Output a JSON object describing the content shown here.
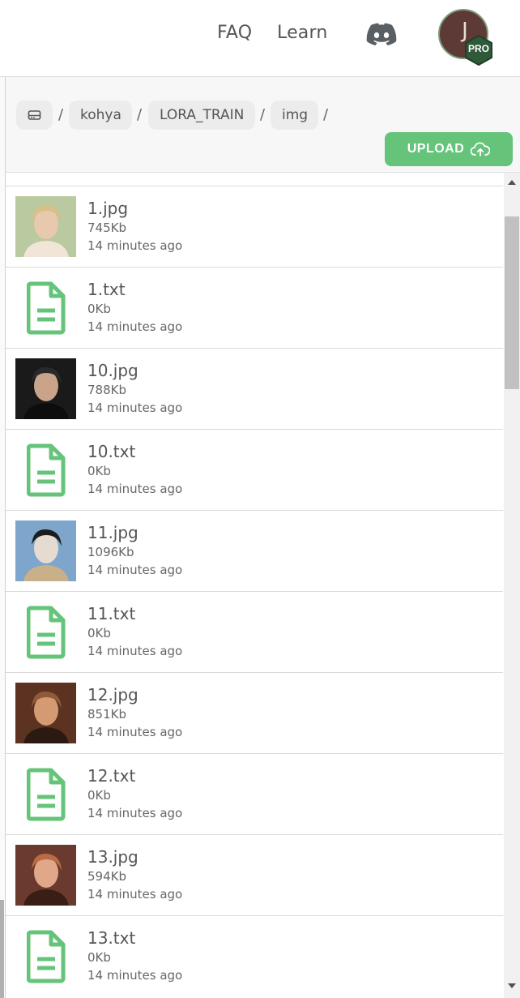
{
  "header": {
    "nav": [
      "FAQ",
      "Learn"
    ],
    "discord_icon": "discord-icon",
    "avatar_letter": "J",
    "badge": "PRO"
  },
  "breadcrumb": {
    "root_icon": "drive-icon",
    "items": [
      "kohya",
      "LORA_TRAIN",
      "img"
    ],
    "separator": "/"
  },
  "upload": {
    "label": "UPLOAD",
    "icon": "cloud-upload-icon"
  },
  "colors": {
    "accent": "#65c37a",
    "text": "#555555",
    "avatar_bg": "#5e3a36"
  },
  "files": [
    {
      "name": "1.jpg",
      "size": "745Kb",
      "time": "14 minutes ago",
      "kind": "image"
    },
    {
      "name": "1.txt",
      "size": "0Kb",
      "time": "14 minutes ago",
      "kind": "text"
    },
    {
      "name": "10.jpg",
      "size": "788Kb",
      "time": "14 minutes ago",
      "kind": "image"
    },
    {
      "name": "10.txt",
      "size": "0Kb",
      "time": "14 minutes ago",
      "kind": "text"
    },
    {
      "name": "11.jpg",
      "size": "1096Kb",
      "time": "14 minutes ago",
      "kind": "image"
    },
    {
      "name": "11.txt",
      "size": "0Kb",
      "time": "14 minutes ago",
      "kind": "text"
    },
    {
      "name": "12.jpg",
      "size": "851Kb",
      "time": "14 minutes ago",
      "kind": "image"
    },
    {
      "name": "12.txt",
      "size": "0Kb",
      "time": "14 minutes ago",
      "kind": "text"
    },
    {
      "name": "13.jpg",
      "size": "594Kb",
      "time": "14 minutes ago",
      "kind": "image"
    },
    {
      "name": "13.txt",
      "size": "0Kb",
      "time": "14 minutes ago",
      "kind": "text"
    }
  ]
}
